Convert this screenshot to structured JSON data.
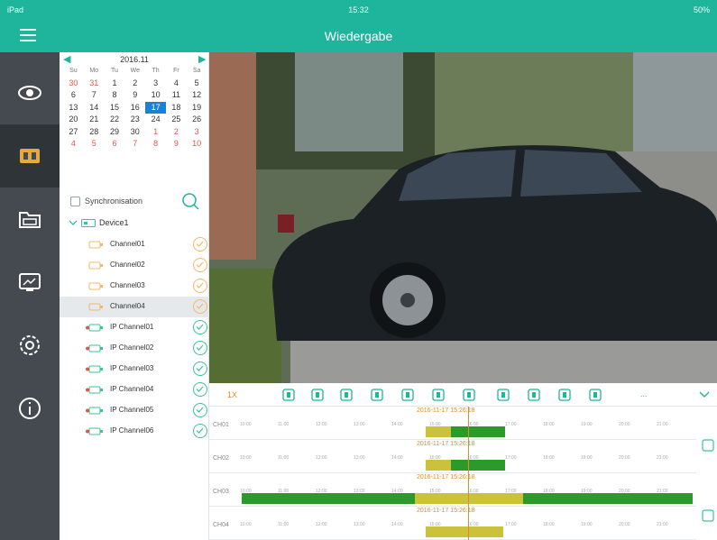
{
  "status_bar": {
    "left": "iPad",
    "time": "15:32",
    "right": "50%"
  },
  "header": {
    "title": "Wiedergabe",
    "menu_icon": "hamburger-menu-icon"
  },
  "nav": [
    {
      "name": "live-view",
      "icon": "eye-icon",
      "active": false
    },
    {
      "name": "playback",
      "icon": "playback-icon",
      "active": true
    },
    {
      "name": "files",
      "icon": "folder-icon",
      "active": false
    },
    {
      "name": "remote-config",
      "icon": "monitor-icon",
      "active": false
    },
    {
      "name": "settings",
      "icon": "gear-icon",
      "active": false
    },
    {
      "name": "info",
      "icon": "info-icon",
      "active": false
    }
  ],
  "calendar": {
    "title": "2016.11",
    "weekdays": [
      "Su",
      "Mo",
      "Tu",
      "We",
      "Th",
      "Fr",
      "Sa"
    ],
    "weeks": [
      [
        "30",
        "31",
        "1",
        "2",
        "3",
        "4",
        "5"
      ],
      [
        "6",
        "7",
        "8",
        "9",
        "10",
        "11",
        "12"
      ],
      [
        "13",
        "14",
        "15",
        "16",
        "17",
        "18",
        "19"
      ],
      [
        "20",
        "21",
        "22",
        "23",
        "24",
        "25",
        "26"
      ],
      [
        "27",
        "28",
        "29",
        "30",
        "1",
        "2",
        "3"
      ],
      [
        "4",
        "5",
        "6",
        "7",
        "8",
        "9",
        "10"
      ]
    ],
    "selected": "17"
  },
  "sync": {
    "label": "Synchronisation",
    "search_icon": "search-icon"
  },
  "device": {
    "label": "Device1"
  },
  "channels": [
    {
      "label": "Channel01",
      "type": "analog",
      "selected": false
    },
    {
      "label": "Channel02",
      "type": "analog",
      "selected": false
    },
    {
      "label": "Channel03",
      "type": "analog",
      "selected": false
    },
    {
      "label": "Channel04",
      "type": "analog",
      "selected": true
    },
    {
      "label": "IP Channel01",
      "type": "ip",
      "selected": false
    },
    {
      "label": "IP Channel02",
      "type": "ip",
      "selected": false
    },
    {
      "label": "IP Channel03",
      "type": "ip",
      "selected": false
    },
    {
      "label": "IP Channel04",
      "type": "ip",
      "selected": false
    },
    {
      "label": "IP Channel05",
      "type": "ip",
      "selected": false
    },
    {
      "label": "IP Channel06",
      "type": "ip",
      "selected": false
    }
  ],
  "toolbar": {
    "speed": "1X",
    "more": "...",
    "buttons": [
      "play-pause-icon",
      "stop-icon",
      "snapshot-icon",
      "record-clip-icon",
      "slow-icon",
      "fast-icon",
      "frame-icon",
      "zoom-icon",
      "fisheye-icon",
      "audio-icon",
      "fullscreen-icon"
    ]
  },
  "timeline": {
    "rows": [
      {
        "label": "CH01",
        "timestamp": "2016-11-17 15:26:18"
      },
      {
        "label": "CH02",
        "timestamp": "2016-11-17 15:26:18"
      },
      {
        "label": "CH03",
        "timestamp": "2016-11-17 15:26:18"
      },
      {
        "label": "CH04",
        "timestamp": "2016-11-17 15:26:18"
      }
    ],
    "tick_labels": [
      "10:00",
      "11:00",
      "12:00",
      "13:00",
      "14:00",
      "15:00",
      "16:00",
      "17:00",
      "18:00",
      "19:00",
      "20:00",
      "21:00"
    ]
  },
  "colors": {
    "accent": "#1fb59d",
    "nav_bg": "#444a4f",
    "record_green": "#2b9a2b",
    "record_yellow": "#c9c23a",
    "marker": "#e08a2b"
  }
}
